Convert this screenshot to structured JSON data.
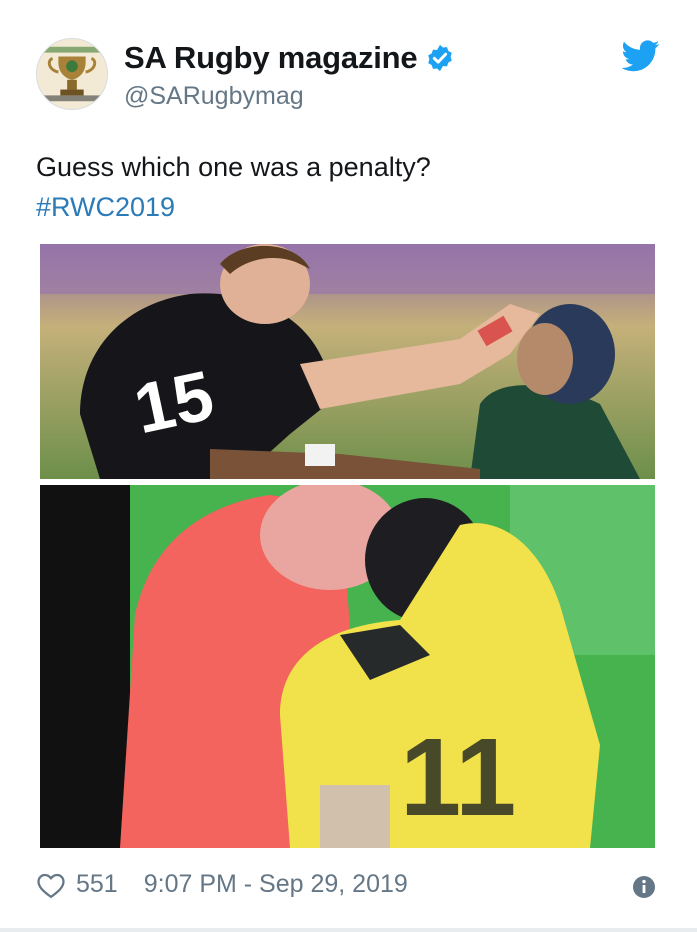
{
  "tweet": {
    "display_name": "SA Rugby magazine",
    "handle": "@SARugbymag",
    "verified": true,
    "text": "Guess which one was a penalty?",
    "hashtag": "#RWC2019",
    "media": [
      {
        "description_icon": "rugby-tackle-photo"
      },
      {
        "description_icon": "rugby-tackle-closeup-photo"
      }
    ],
    "likes": "551",
    "timestamp": "9:07 PM - Sep 29, 2019"
  },
  "icons": {
    "verified": "verified-badge-icon",
    "brand": "twitter-bird-icon",
    "like": "heart-icon",
    "info": "info-icon"
  },
  "colors": {
    "link": "#2b7bb9",
    "brand": "#1da1f2",
    "muted": "#657786",
    "text": "#14171a"
  }
}
